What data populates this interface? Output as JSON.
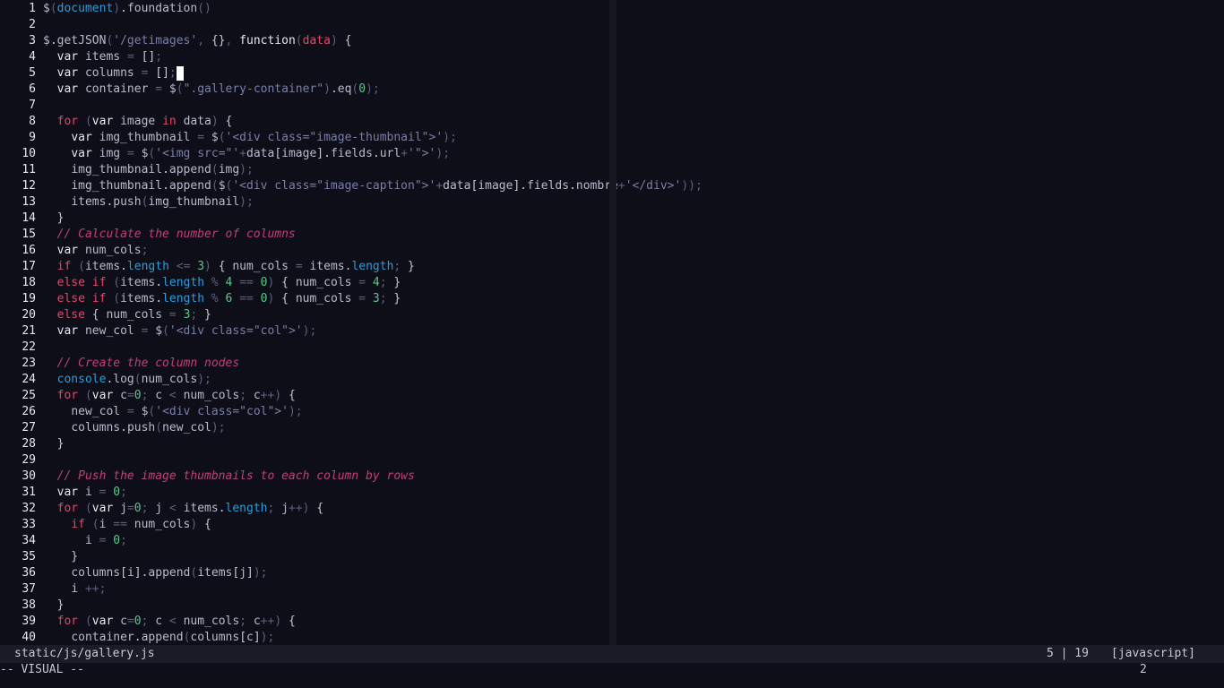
{
  "editor": {
    "lines": [
      {
        "n": "1",
        "t": "$(document).foundation()"
      },
      {
        "n": "2",
        "t": ""
      },
      {
        "n": "3",
        "t": "$.getJSON('/getimages', {}, function(data) {"
      },
      {
        "n": "4",
        "t": "  var items = [];"
      },
      {
        "n": "5",
        "t": "  var columns = [];"
      },
      {
        "n": "6",
        "t": "  var container = $(\".gallery-container\").eq(0);"
      },
      {
        "n": "7",
        "t": ""
      },
      {
        "n": "8",
        "t": "  for (var image in data) {"
      },
      {
        "n": "9",
        "t": "    var img_thumbnail = $('<div class=\"image-thumbnail\">');"
      },
      {
        "n": "10",
        "t": "    var img = $('<img src=\"'+data[image].fields.url+'\">');"
      },
      {
        "n": "11",
        "t": "    img_thumbnail.append(img);"
      },
      {
        "n": "12",
        "t": "    img_thumbnail.append($('<div class=\"image-caption\">'+data[image].fields.nombre+'</div>'));"
      },
      {
        "n": "13",
        "t": "    items.push(img_thumbnail);"
      },
      {
        "n": "14",
        "t": "  }"
      },
      {
        "n": "15",
        "t": "  // Calculate the number of columns"
      },
      {
        "n": "16",
        "t": "  var num_cols;"
      },
      {
        "n": "17",
        "t": "  if (items.length <= 3) { num_cols = items.length; }"
      },
      {
        "n": "18",
        "t": "  else if (items.length % 4 == 0) { num_cols = 4; }"
      },
      {
        "n": "19",
        "t": "  else if (items.length % 6 == 0) { num_cols = 3; }"
      },
      {
        "n": "20",
        "t": "  else { num_cols = 3; }"
      },
      {
        "n": "21",
        "t": "  var new_col = $('<div class=\"col\">');"
      },
      {
        "n": "22",
        "t": ""
      },
      {
        "n": "23",
        "t": "  // Create the column nodes"
      },
      {
        "n": "24",
        "t": "  console.log(num_cols);"
      },
      {
        "n": "25",
        "t": "  for (var c=0; c < num_cols; c++) {"
      },
      {
        "n": "26",
        "t": "    new_col = $('<div class=\"col\">');"
      },
      {
        "n": "27",
        "t": "    columns.push(new_col);"
      },
      {
        "n": "28",
        "t": "  }"
      },
      {
        "n": "29",
        "t": ""
      },
      {
        "n": "30",
        "t": "  // Push the image thumbnails to each column by rows"
      },
      {
        "n": "31",
        "t": "  var i = 0;"
      },
      {
        "n": "32",
        "t": "  for (var j=0; j < items.length; j++) {"
      },
      {
        "n": "33",
        "t": "    if (i == num_cols) {"
      },
      {
        "n": "34",
        "t": "      i = 0;"
      },
      {
        "n": "35",
        "t": "    }"
      },
      {
        "n": "36",
        "t": "    columns[i].append(items[j]);"
      },
      {
        "n": "37",
        "t": "    i ++;"
      },
      {
        "n": "38",
        "t": "  }"
      },
      {
        "n": "39",
        "t": "  for (var c=0; c < num_cols; c++) {"
      },
      {
        "n": "40",
        "t": "    container.append(columns[c]);"
      }
    ]
  },
  "status": {
    "file_path": "static/js/gallery.js",
    "position": "5 | 19",
    "filetype": "[javascript]"
  },
  "cmdline": {
    "mode": "-- VISUAL --",
    "selection_count": "2"
  },
  "colors": {
    "background": "#0d0e18",
    "keyword": "#e0486a",
    "comment": "#c0407a",
    "number": "#56c98a",
    "property": "#2f9cd8"
  }
}
